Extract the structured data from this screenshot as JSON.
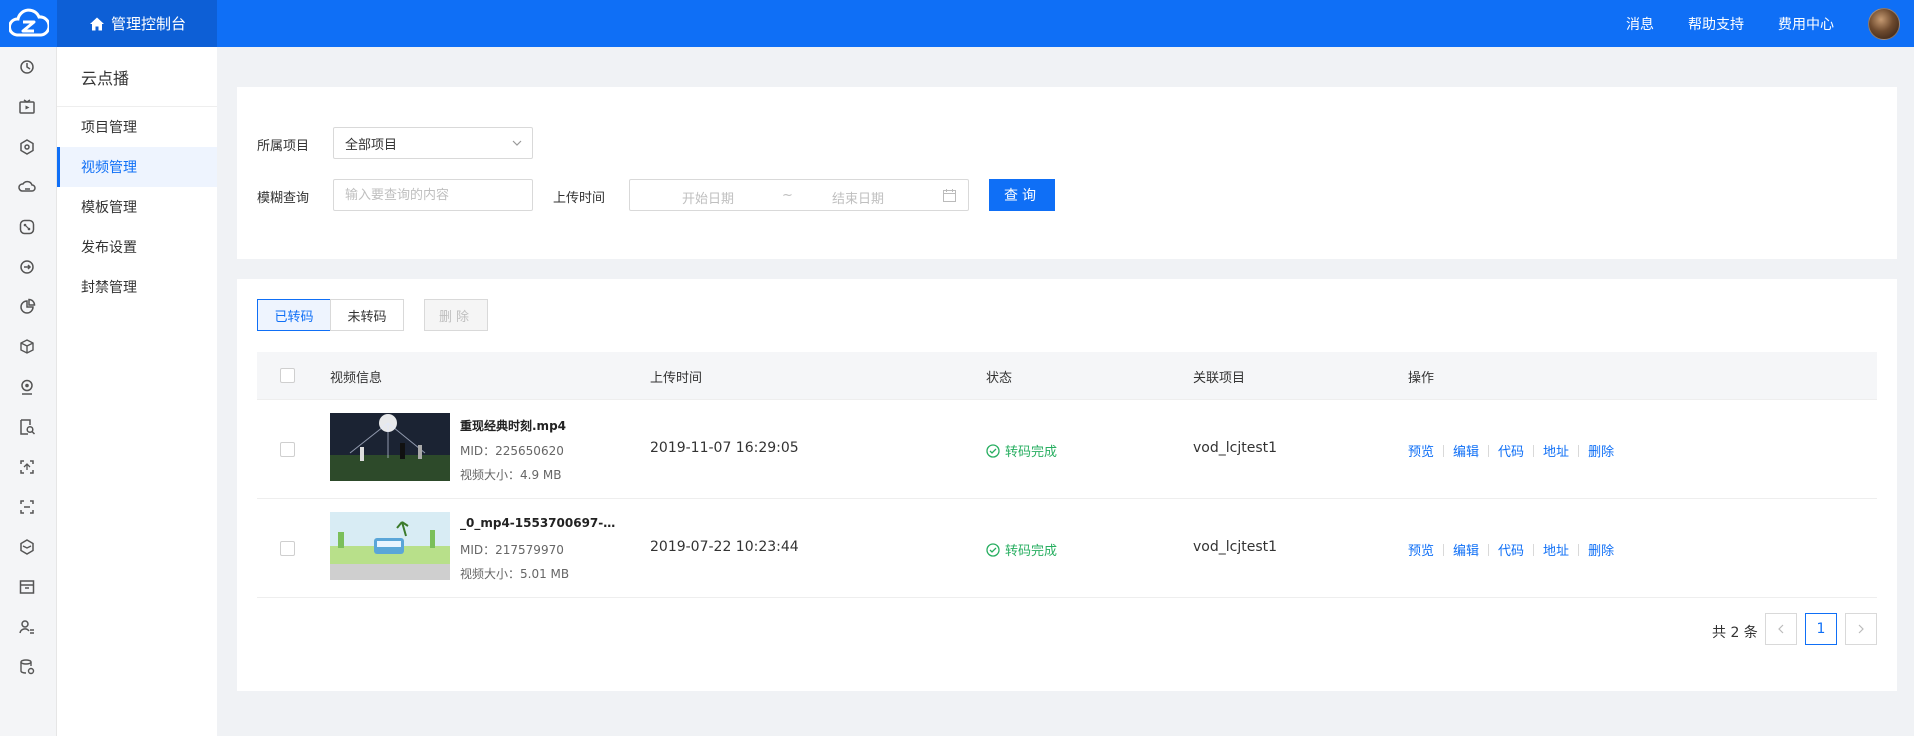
{
  "header": {
    "console_label": "管理控制台",
    "links": [
      "消息",
      "帮助支持",
      "费用中心"
    ]
  },
  "sidebar": {
    "title": "云点播",
    "items": [
      {
        "label": "项目管理",
        "active": false
      },
      {
        "label": "视频管理",
        "active": true
      },
      {
        "label": "模板管理",
        "active": false
      },
      {
        "label": "发布设置",
        "active": false
      },
      {
        "label": "封禁管理",
        "active": false
      }
    ]
  },
  "filters": {
    "project_label": "所属项目",
    "project_value": "全部项目",
    "search_label": "模糊查询",
    "search_placeholder": "输入要查询的内容",
    "upload_time_label": "上传时间",
    "start_placeholder": "开始日期",
    "range_sep": "~",
    "end_placeholder": "结束日期",
    "query_button": "查询"
  },
  "list": {
    "tabs": [
      "已转码",
      "未转码"
    ],
    "delete_button": "删除",
    "columns": [
      "视频信息",
      "上传时间",
      "状态",
      "关联项目",
      "操作"
    ],
    "rows": [
      {
        "name": "重现经典时刻.mp4",
        "mid": "MID：225650620",
        "size": "视频大小：4.9 MB",
        "upload_time": "2019-11-07 16:29:05",
        "status": "转码完成",
        "project": "vod_lcjtest1"
      },
      {
        "name": "_0_mp4-1553700697-5...",
        "mid": "MID：217579970",
        "size": "视频大小：5.01 MB",
        "upload_time": "2019-07-22 10:23:44",
        "status": "转码完成",
        "project": "vod_lcjtest1"
      }
    ],
    "ops": [
      "预览",
      "编辑",
      "代码",
      "地址",
      "删除"
    ]
  },
  "pagination": {
    "total": "共 2 条",
    "current_page": "1"
  },
  "colors": {
    "primary": "#0f6ff6",
    "success": "#27ae60"
  }
}
